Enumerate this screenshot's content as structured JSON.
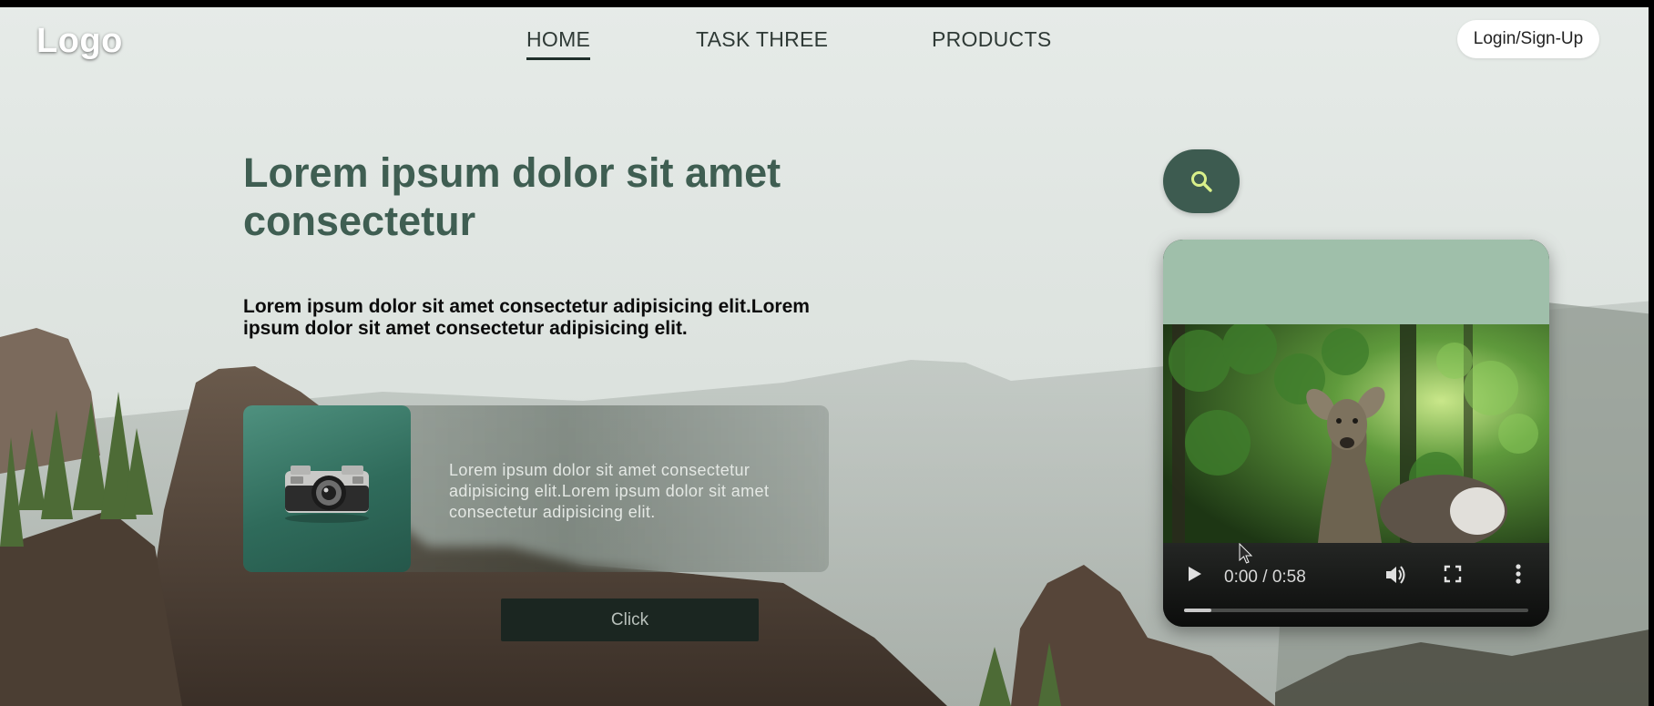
{
  "brand": {
    "logo": "Logo"
  },
  "nav": {
    "items": [
      {
        "label": "HOME",
        "active": true
      },
      {
        "label": "TASK THREE",
        "active": false
      },
      {
        "label": "PRODUCTS",
        "active": false
      }
    ],
    "login_label": "Login/Sign-Up"
  },
  "hero": {
    "headline": "Lorem ipsum dolor sit amet consectetur",
    "intro": "Lorem ipsum dolor sit amet consectetur adipisicing elit.Lorem ipsum dolor sit amet consectetur adipisicing elit."
  },
  "feature": {
    "icon": "camera-icon",
    "text": "Lorem ipsum dolor sit amet consectetur adipisicing elit.Lorem ipsum dolor sit amet consectetur adipisicing elit."
  },
  "cta": {
    "label": "Click"
  },
  "search": {
    "icon": "search-icon"
  },
  "video": {
    "time": "0:00 / 0:58",
    "progress": 0.08,
    "controls": [
      "play-icon",
      "volume-icon",
      "fullscreen-icon",
      "more-icon"
    ]
  },
  "colors": {
    "headline": "#3f5e52",
    "accent": "#3d5b50",
    "video_header": "#9fbfaa",
    "search_glyph": "#d9f08a"
  }
}
